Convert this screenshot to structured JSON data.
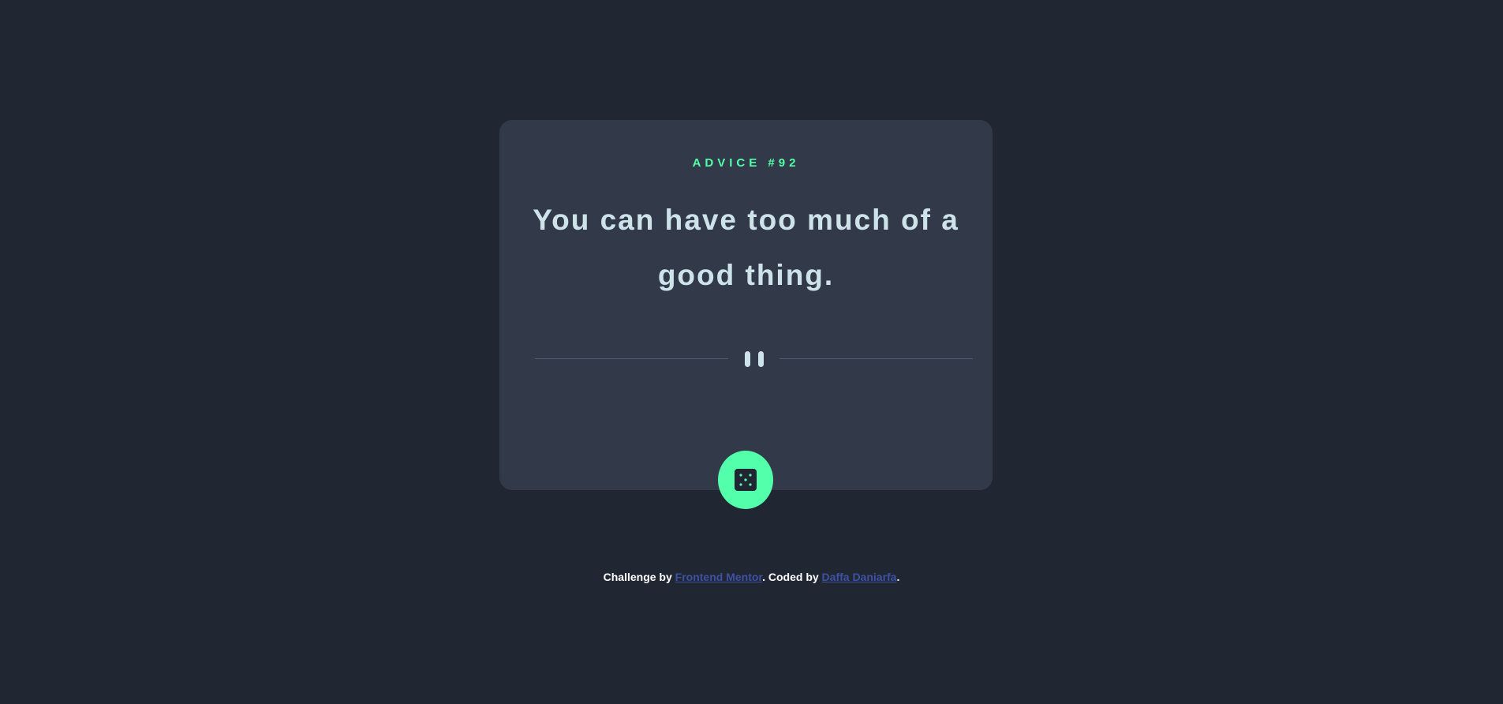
{
  "card": {
    "advice_label": "ADVICE #92",
    "advice_text": "You can have too much of a good thing.",
    "divider_icon": "pause-icon"
  },
  "dice_button": {
    "icon": "dice-icon"
  },
  "attribution": {
    "prefix": "Challenge by ",
    "challenge_link": "Frontend Mentor",
    "middle": ". Coded by ",
    "author_link": "Daffa Daniarfa",
    "suffix": "."
  },
  "colors": {
    "background": "#202632",
    "card": "#323a49",
    "accent": "#53ffaa",
    "text": "#cee3e9",
    "divider": "#4f5d74",
    "link": "#3e52a3"
  }
}
